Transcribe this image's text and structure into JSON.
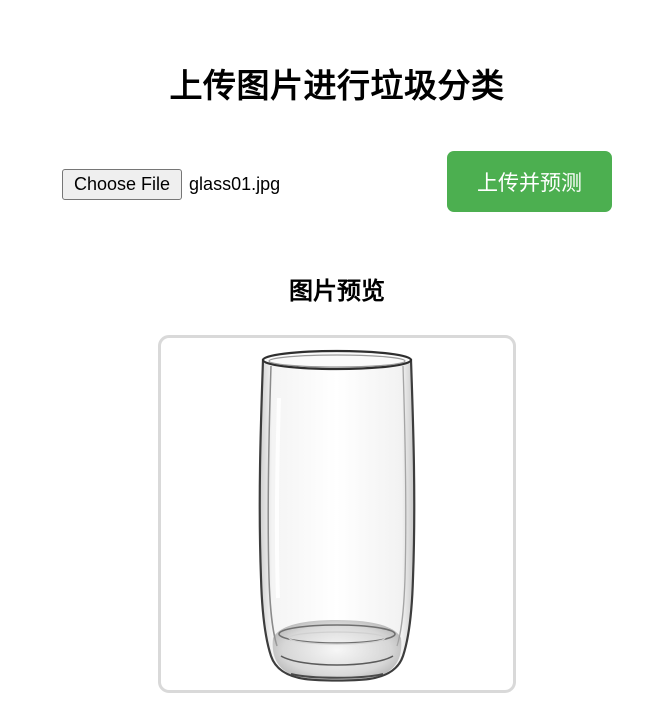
{
  "page": {
    "title": "上传图片进行垃圾分类"
  },
  "upload": {
    "choose_label": "Choose File",
    "file_name": "glass01.jpg",
    "submit_label": "上传并预测"
  },
  "preview": {
    "heading": "图片预览",
    "image_subject": "drinking-glass",
    "border_color": "#d9d9d9"
  },
  "colors": {
    "submit_bg": "#4caf50",
    "submit_text": "#ffffff"
  }
}
